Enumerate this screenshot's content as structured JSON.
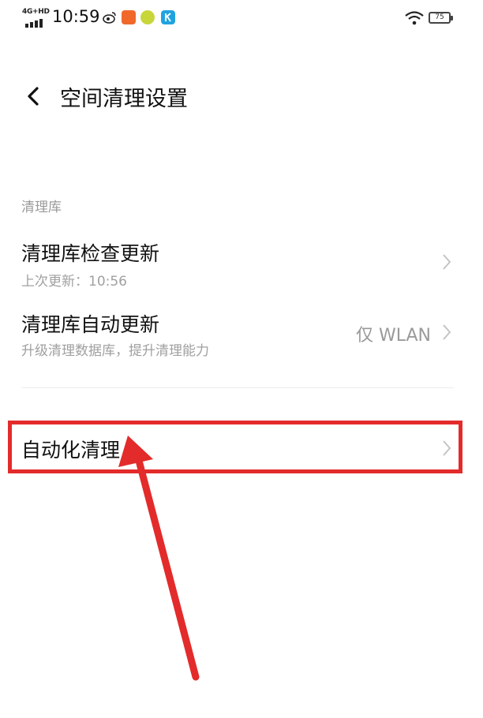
{
  "status_bar": {
    "network": "4G+HD",
    "time": "10:59",
    "battery": "75",
    "icons": [
      "signal-icon",
      "weibo-icon",
      "app-orange-icon",
      "app-green-icon",
      "app-blue-k-icon",
      "wifi-icon",
      "battery-icon"
    ]
  },
  "header": {
    "back_icon": "chevron-left-icon",
    "title": "空间清理设置"
  },
  "section": {
    "label": "清理库"
  },
  "rows": [
    {
      "title": "清理库检查更新",
      "subtitle": "上次更新：10:56",
      "value": ""
    },
    {
      "title": "清理库自动更新",
      "subtitle": "升级清理数据库，提升清理能力",
      "value": "仅 WLAN"
    },
    {
      "title": "自动化清理",
      "subtitle": "",
      "value": ""
    }
  ],
  "annotation": {
    "highlight_color": "#e32b2b"
  }
}
